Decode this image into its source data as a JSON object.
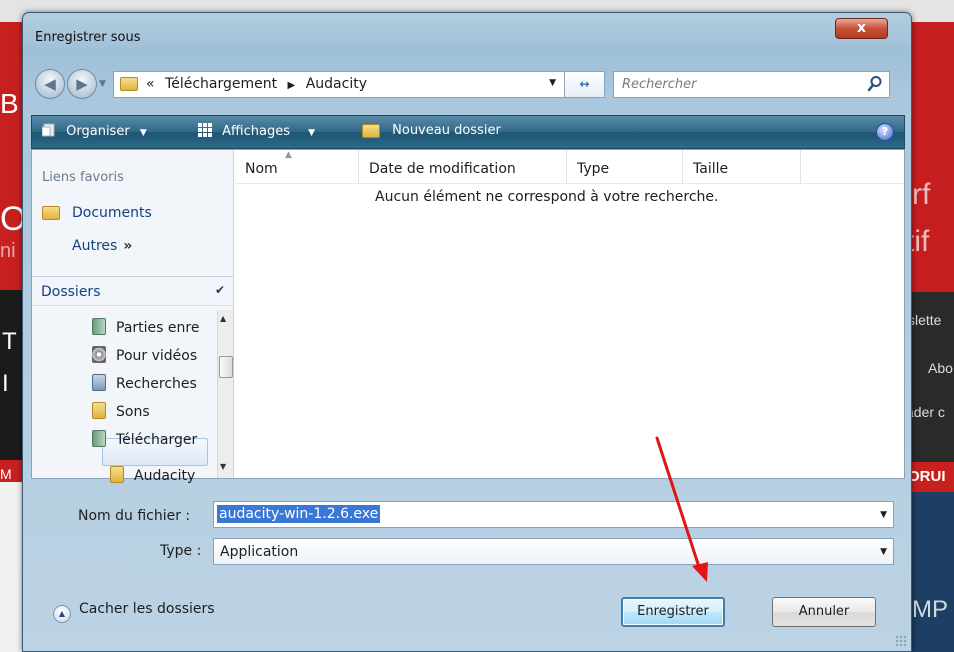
{
  "dialog": {
    "title": "Enregistrer sous",
    "close_label": "x"
  },
  "address": {
    "prefix": "«",
    "path": [
      "Téléchargement",
      "Audacity"
    ],
    "search_placeholder": "Rechercher"
  },
  "toolbar": {
    "organize": "Organiser",
    "views": "Affichages",
    "new_folder": "Nouveau dossier",
    "help": "?"
  },
  "sidebar": {
    "favorites_title": "Liens favoris",
    "favorites": [
      "Documents"
    ],
    "more_label": "Autres",
    "more_chevron": "»",
    "folders_title": "Dossiers",
    "tree": [
      {
        "label": "Parties enre",
        "icon": "shared-folder-icon"
      },
      {
        "label": "Pour vidéos",
        "icon": "disc-icon"
      },
      {
        "label": "Recherches",
        "icon": "saved-search-icon"
      },
      {
        "label": "Sons",
        "icon": "folder-icon"
      },
      {
        "label": "Télécharger",
        "icon": "downloads-folder-icon"
      },
      {
        "label": "Audacity",
        "icon": "folder-icon",
        "selected": true
      }
    ]
  },
  "list": {
    "columns": [
      "Nom",
      "Date de modification",
      "Type",
      "Taille"
    ],
    "empty_message": "Aucun élément ne correspond à votre recherche."
  },
  "form": {
    "filename_label": "Nom du fichier :",
    "filename_value": "audacity-win-1.2.6.exe",
    "type_label": "Type :",
    "type_value": "Application"
  },
  "footer": {
    "hide_folders": "Cacher les dossiers",
    "save": "Enregistrer",
    "cancel": "Annuler"
  },
  "background": {
    "right_texts": [
      "rf",
      "tif",
      "slette",
      "Abo",
      "ader c",
      "ORUI",
      "MP"
    ],
    "left_texts": [
      "B",
      "O",
      "ni",
      "T",
      "I",
      "M"
    ]
  },
  "annotation": {
    "color": "#e11515"
  }
}
